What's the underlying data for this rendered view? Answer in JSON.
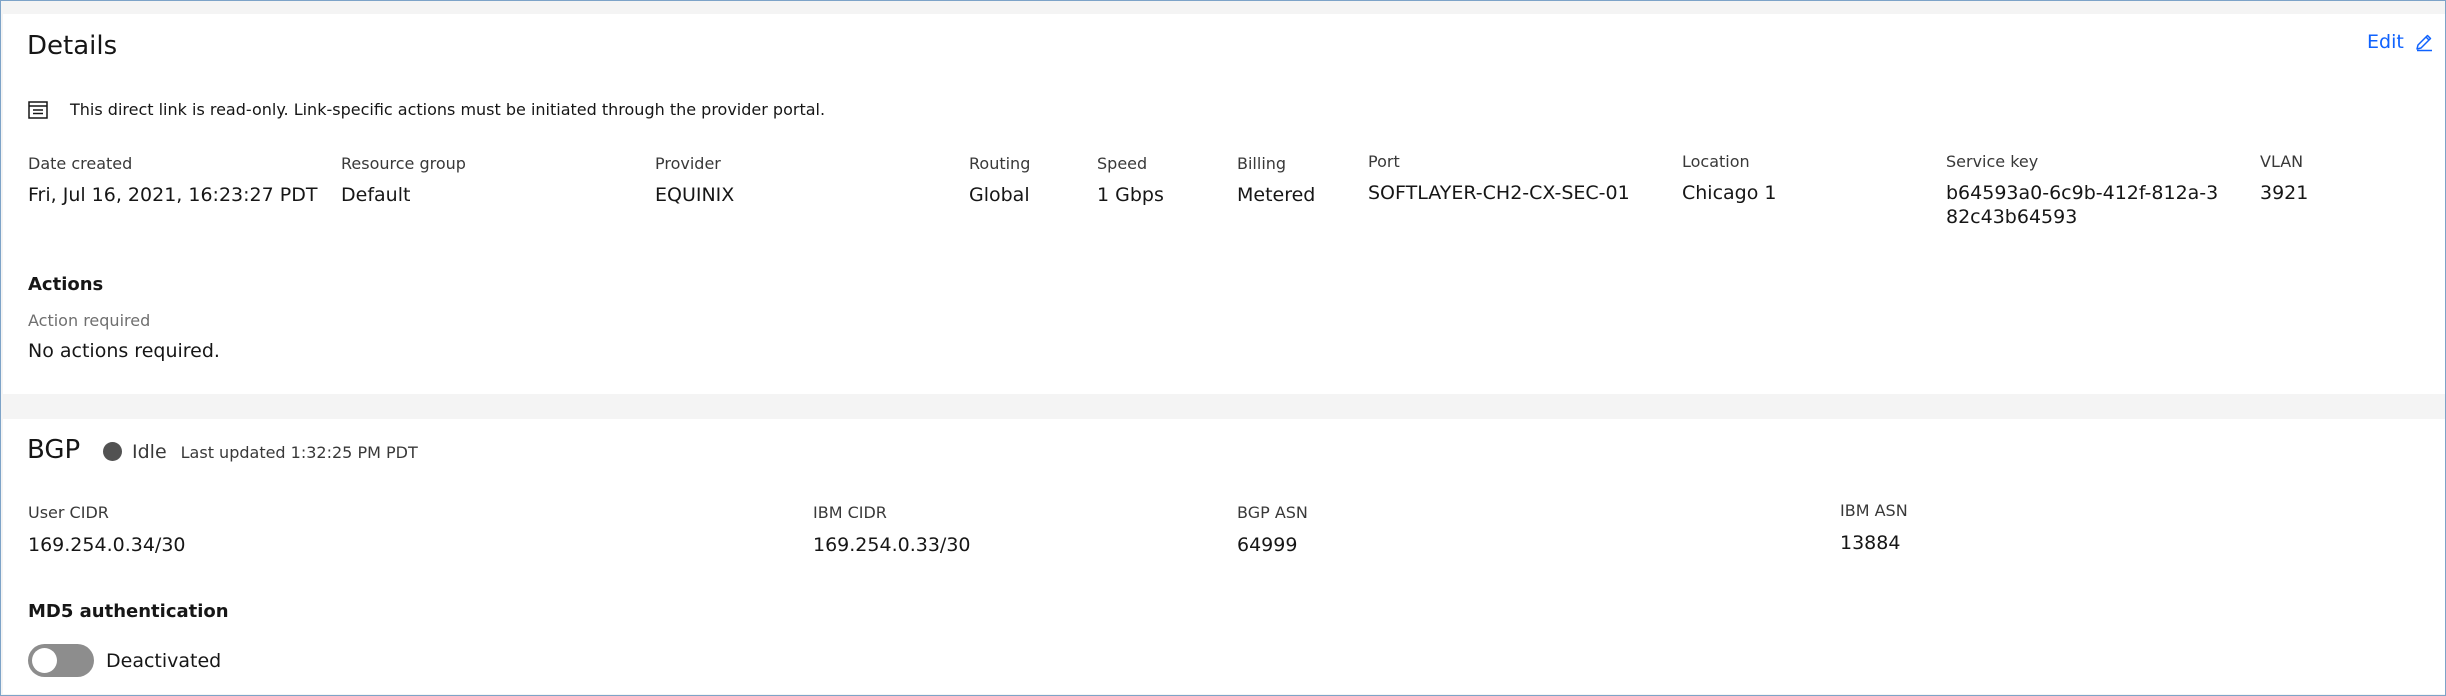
{
  "details": {
    "title": "Details",
    "edit_label": "Edit",
    "notice": "This direct link is read-only. Link-specific actions must be initiated through the provider portal.",
    "fields": {
      "date_created": {
        "label": "Date created",
        "value": "Fri, Jul 16, 2021, 16:23:27 PDT"
      },
      "resource_group": {
        "label": "Resource group",
        "value": "Default"
      },
      "provider": {
        "label": "Provider",
        "value": "EQUINIX"
      },
      "routing": {
        "label": "Routing",
        "value": "Global"
      },
      "speed": {
        "label": "Speed",
        "value": "1 Gbps"
      },
      "billing": {
        "label": "Billing",
        "value": "Metered"
      },
      "port": {
        "label": "Port",
        "value": "SOFTLAYER-CH2-CX-SEC-01"
      },
      "location": {
        "label": "Location",
        "value": "Chicago 1"
      },
      "service_key": {
        "label": "Service key",
        "value_line1": "b64593a0-6c9b-412f-812a-3",
        "value_line2": "82c43b64593"
      },
      "vlan": {
        "label": "VLAN",
        "value": "3921"
      }
    },
    "actions": {
      "title": "Actions",
      "label": "Action required",
      "value": "No actions required."
    }
  },
  "bgp": {
    "title": "BGP",
    "status": "Idle",
    "last_updated": "Last updated 1:32:25 PM PDT",
    "status_color": "#525252",
    "fields": {
      "user_cidr": {
        "label": "User CIDR",
        "value": "169.254.0.34/30"
      },
      "ibm_cidr": {
        "label": "IBM CIDR",
        "value": "169.254.0.33/30"
      },
      "bgp_asn": {
        "label": "BGP ASN",
        "value": "64999"
      },
      "ibm_asn": {
        "label": "IBM ASN",
        "value": "13884"
      }
    },
    "md5": {
      "title": "MD5 authentication",
      "toggle_state": "off",
      "toggle_label": "Deactivated"
    }
  },
  "colors": {
    "link": "#0f62fe",
    "toggle_off": "#8d8d8d"
  }
}
